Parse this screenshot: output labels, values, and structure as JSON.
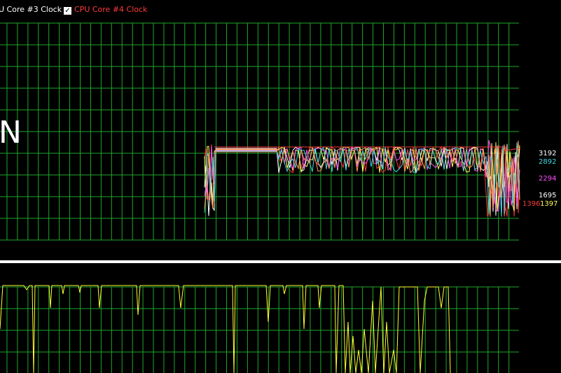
{
  "legend": {
    "items": [
      {
        "label": "U Core #3 Clock",
        "color": "#ffffff",
        "checked": false
      },
      {
        "label": "CPU Core #4 Clock",
        "color": "#ff3b3b",
        "checked": true
      }
    ],
    "check_glyph": "✓"
  },
  "top_graph": {
    "overlay_letter": "N",
    "line_colors": [
      "#ffffff",
      "#ff3b3b",
      "#ffff60",
      "#ff50ff",
      "#40d8e0",
      "#ff9a5a"
    ],
    "grid_color": "#1ea82a",
    "value_labels": [
      {
        "text": "3192",
        "color": "#ffffff"
      },
      {
        "text": "2892",
        "color": "#40d8e0"
      },
      {
        "text": "2294",
        "color": "#ff50ff"
      },
      {
        "text": "1695",
        "color": "#ffffff"
      },
      {
        "text": "1396",
        "color": "#ff3b3b"
      },
      {
        "text": "1397",
        "color": "#ffff60"
      }
    ]
  },
  "bottom_graph": {
    "line_color": "#ffff30",
    "grid_color": "#1ea82a"
  },
  "divider_color": "#ffffff"
}
